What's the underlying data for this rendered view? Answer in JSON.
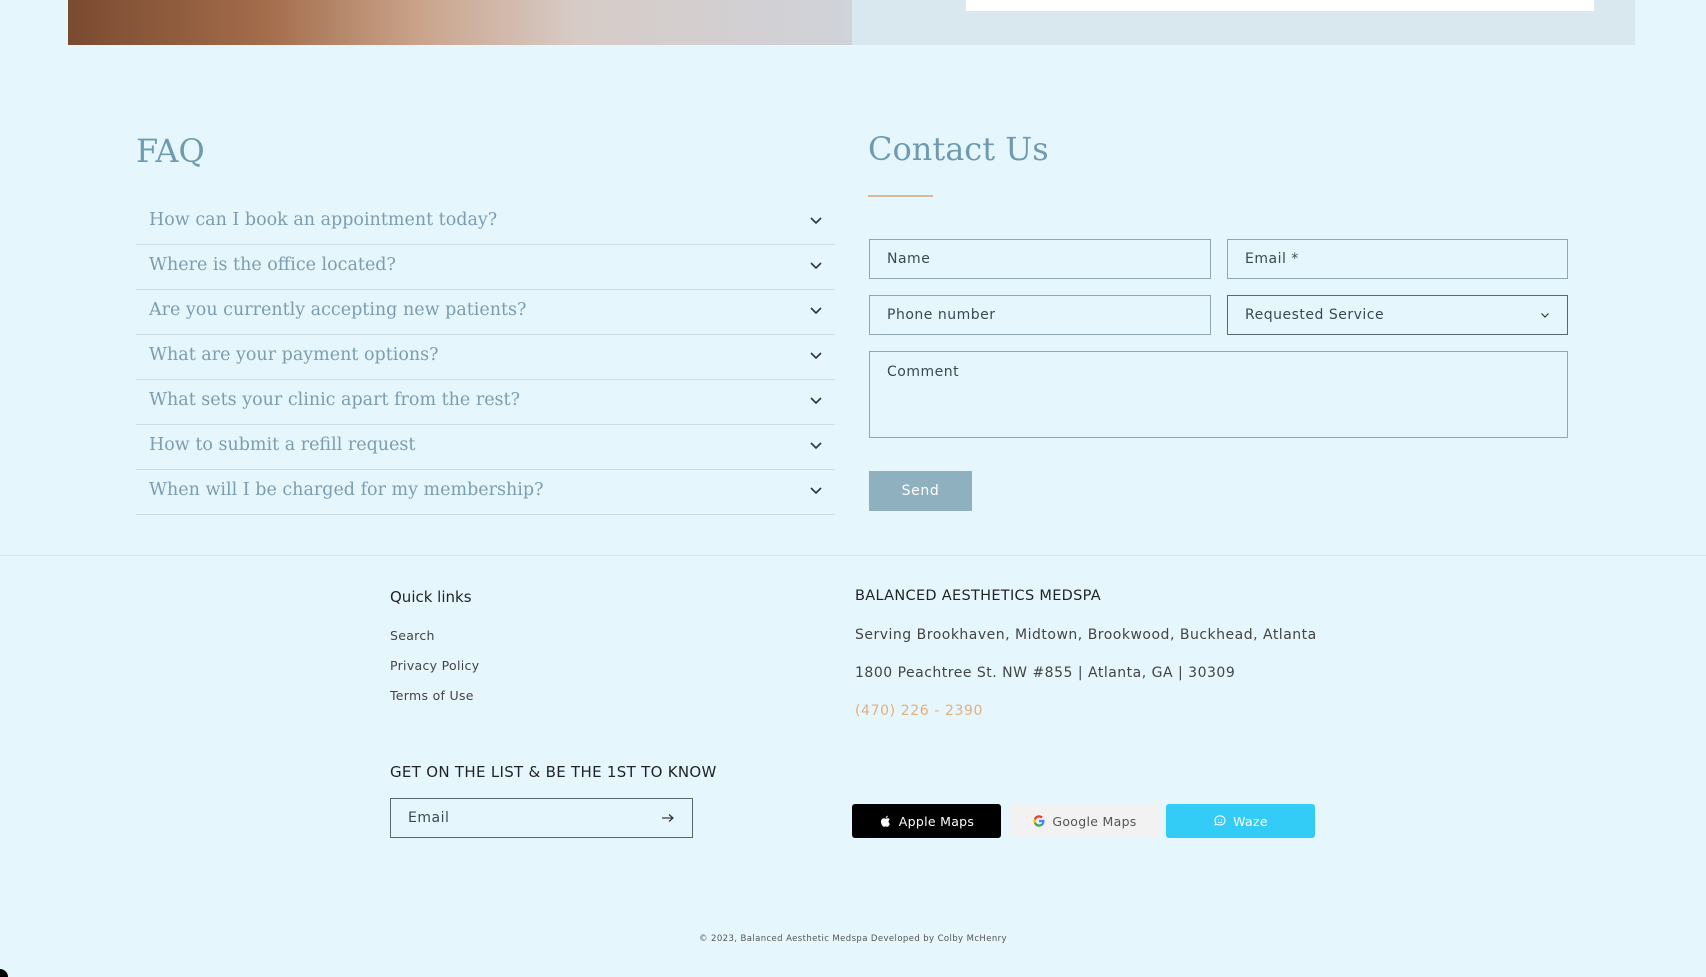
{
  "faq": {
    "title": "FAQ",
    "items": [
      {
        "question": "How can I book an appointment today?"
      },
      {
        "question": "Where is the office located?"
      },
      {
        "question": "Are you currently accepting new patients?"
      },
      {
        "question": "What are your payment options?"
      },
      {
        "question": "What sets your clinic apart from the rest?"
      },
      {
        "question": "How to submit a refill request"
      },
      {
        "question": "When will I be charged for my membership?"
      }
    ]
  },
  "contact": {
    "title": "Contact Us",
    "name_placeholder": "Name",
    "email_placeholder": "Email *",
    "phone_placeholder": "Phone number",
    "service_selected": "Requested Service",
    "comment_placeholder": "Comment",
    "send_label": "Send"
  },
  "footer": {
    "quick_links_title": "Quick links",
    "quick_links": [
      "Search",
      "Privacy Policy",
      "Terms of Use"
    ],
    "business_name": "BALANCED AESTHETICS MEDSPA",
    "service_area": "Serving Brookhaven, Midtown, Brookwood, Buckhead, Atlanta",
    "address": "1800 Peachtree St. NW #855 | Atlanta, GA | 30309",
    "phone": "(470) 226 - 2390",
    "newsletter_title": "GET ON THE LIST & BE THE 1ST TO KNOW",
    "newsletter_placeholder": "Email",
    "maps": {
      "apple": "Apple Maps",
      "google": "Google Maps",
      "waze": "Waze"
    },
    "copyright": "© 2023, Balanced Aesthetic Medspa Developed by Colby McHenry"
  },
  "colors": {
    "background": "#e6f6fd",
    "accent": "#6f9ab0",
    "phone_link": "#e0b07f",
    "waze": "#33ccf7"
  },
  "icons": [
    "chevron-down-icon",
    "arrow-right-icon",
    "apple-icon",
    "google-icon",
    "waze-icon"
  ]
}
